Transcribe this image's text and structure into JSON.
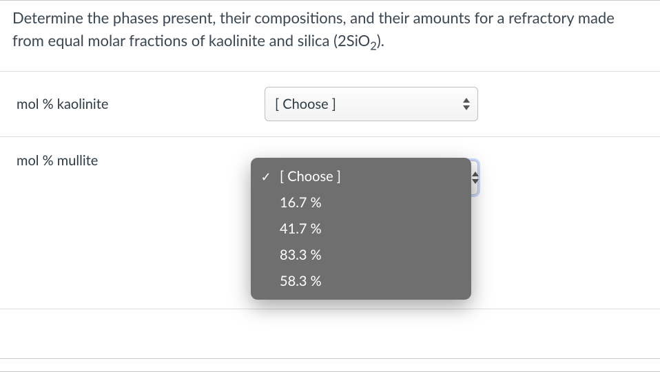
{
  "question": {
    "text_pre": "Determine the phases present, their compositions, and their amounts for a refractory made from equal molar fractions of kaolinite and silica (2SiO",
    "subscript": "2",
    "text_post": ")."
  },
  "rows": [
    {
      "label": "mol % kaolinite",
      "selected": "[ Choose ]",
      "open": false
    },
    {
      "label": "mol % mullite",
      "selected": "[ Choose ]",
      "open": true
    }
  ],
  "dropdown": {
    "placeholder": "[ Choose ]",
    "options": [
      "16.7 %",
      "41.7 %",
      "83.3 %",
      "58.3 %"
    ]
  }
}
